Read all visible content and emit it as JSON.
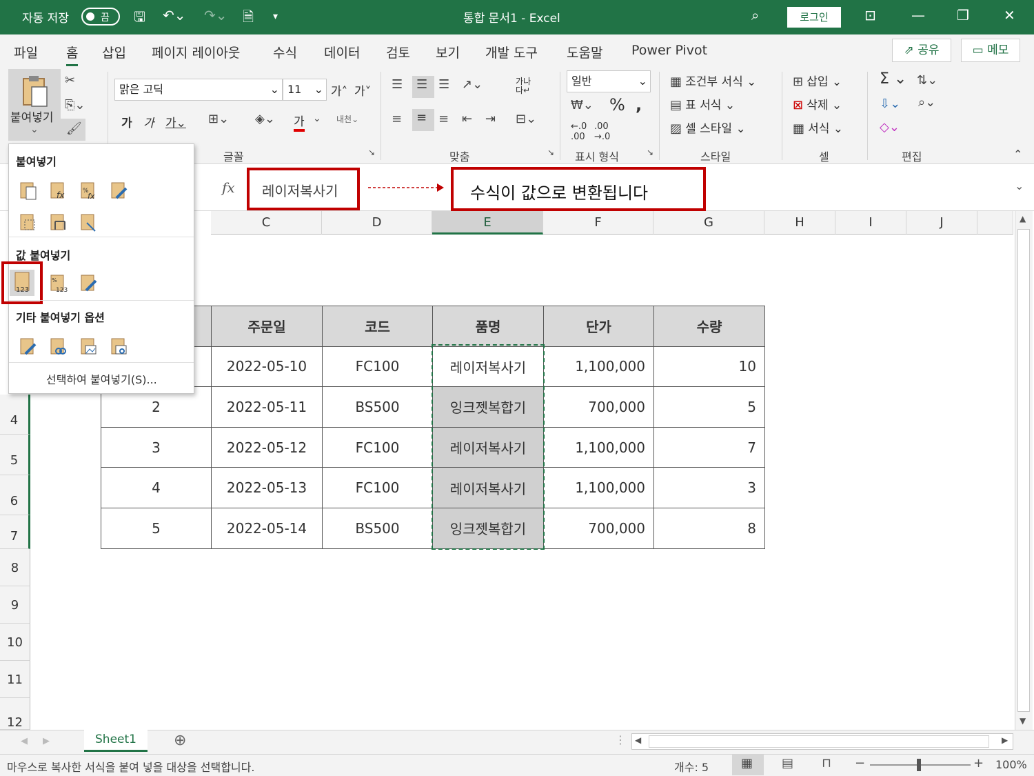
{
  "titlebar": {
    "autosave_label": "자동 저장",
    "autosave_state": "끔",
    "doc_title": "통합 문서1 - Excel",
    "login_label": "로그인"
  },
  "menu": {
    "items": [
      "파일",
      "홈",
      "삽입",
      "페이지 레이아웃",
      "수식",
      "데이터",
      "검토",
      "보기",
      "개발 도구",
      "도움말",
      "Power Pivot"
    ],
    "active": "홈",
    "share_label": "공유",
    "memo_label": "메모"
  },
  "ribbon": {
    "paste_label": "붙여넣기",
    "font_name": "맑은 고딕",
    "font_size": "11",
    "font_group_label": "글꼴",
    "align_group_label": "맞춤",
    "number_format": "일반",
    "number_group_label": "표시 형식",
    "conditional_format": "조건부 서식",
    "table_format": "표 서식",
    "cell_style": "셀 스타일",
    "style_group_label": "스타일",
    "insert_label": "삽입",
    "delete_label": "삭제",
    "format_label": "서식",
    "cells_group_label": "셀",
    "edit_group_label": "편집",
    "wrap_label": "가나다"
  },
  "formula": {
    "fx": "fx",
    "cell_value": "레이저복사기",
    "annotation": "수식이 값으로 변환됩니다"
  },
  "paste_menu": {
    "section_paste": "붙여넣기",
    "section_values": "값 붙여넣기",
    "section_other": "기타 붙여넣기 옵션",
    "paste_special": "선택하여 붙여넣기(S)..."
  },
  "columns": [
    "C",
    "D",
    "E",
    "F",
    "G",
    "H",
    "I",
    "J"
  ],
  "rows": [
    "4",
    "5",
    "6",
    "7",
    "8",
    "9",
    "10",
    "11",
    "12"
  ],
  "table": {
    "headers": [
      "주문일",
      "코드",
      "품명",
      "단가",
      "수량"
    ],
    "rows": [
      {
        "no": "",
        "date": "2022-05-10",
        "code": "FC100",
        "item": "레이저복사기",
        "price": "1,100,000",
        "qty": "10"
      },
      {
        "no": "2",
        "date": "2022-05-11",
        "code": "BS500",
        "item": "잉크젯복합기",
        "price": "700,000",
        "qty": "5"
      },
      {
        "no": "3",
        "date": "2022-05-12",
        "code": "FC100",
        "item": "레이저복사기",
        "price": "1,100,000",
        "qty": "7"
      },
      {
        "no": "4",
        "date": "2022-05-13",
        "code": "FC100",
        "item": "레이저복사기",
        "price": "1,100,000",
        "qty": "3"
      },
      {
        "no": "5",
        "date": "2022-05-14",
        "code": "BS500",
        "item": "잉크젯복합기",
        "price": "700,000",
        "qty": "8"
      }
    ]
  },
  "sheet_tab": "Sheet1",
  "status": {
    "message": "마우스로 복사한 서식을 붙여 넣을 대상을 선택합니다.",
    "count": "개수: 5",
    "zoom": "100%"
  },
  "colors": {
    "excel_green": "#217346",
    "highlight_red": "#c00000"
  }
}
